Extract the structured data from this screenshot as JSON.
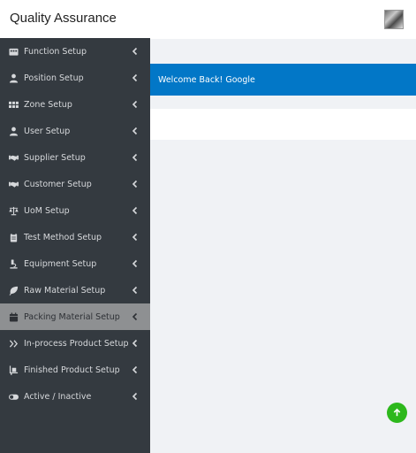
{
  "app": {
    "title": "Quality Assurance"
  },
  "sidebar": {
    "items": [
      {
        "label": "Function Setup",
        "icon": "building-icon"
      },
      {
        "label": "Position Setup",
        "icon": "user-icon"
      },
      {
        "label": "Zone Setup",
        "icon": "grid-icon"
      },
      {
        "label": "User Setup",
        "icon": "user-icon"
      },
      {
        "label": "Supplier Setup",
        "icon": "handshake-icon"
      },
      {
        "label": "Customer Setup",
        "icon": "handshake-icon"
      },
      {
        "label": "UoM Setup",
        "icon": "balance-scale-icon"
      },
      {
        "label": "Test Method Setup",
        "icon": "clipboard-icon"
      },
      {
        "label": "Equipment Setup",
        "icon": "microscope-icon"
      },
      {
        "label": "Raw Material Setup",
        "icon": "leaf-icon"
      },
      {
        "label": "Packing Material Setup",
        "icon": "calendar-icon",
        "active": true
      },
      {
        "label": "In-process Product Setup",
        "icon": "double-chevron-right-icon"
      },
      {
        "label": "Finished Product Setup",
        "icon": "dolly-icon"
      },
      {
        "label": "Active / Inactive",
        "icon": "toggle-icon"
      }
    ]
  },
  "main": {
    "welcome_message": "Welcome Back! Google"
  },
  "colors": {
    "sidebar_bg": "#343a40",
    "active_item_bg": "#8e9092",
    "welcome_bg": "#0277c7",
    "scroll_top_bg": "#2db81c"
  },
  "scroll_top": {
    "icon": "arrow-up-icon"
  }
}
